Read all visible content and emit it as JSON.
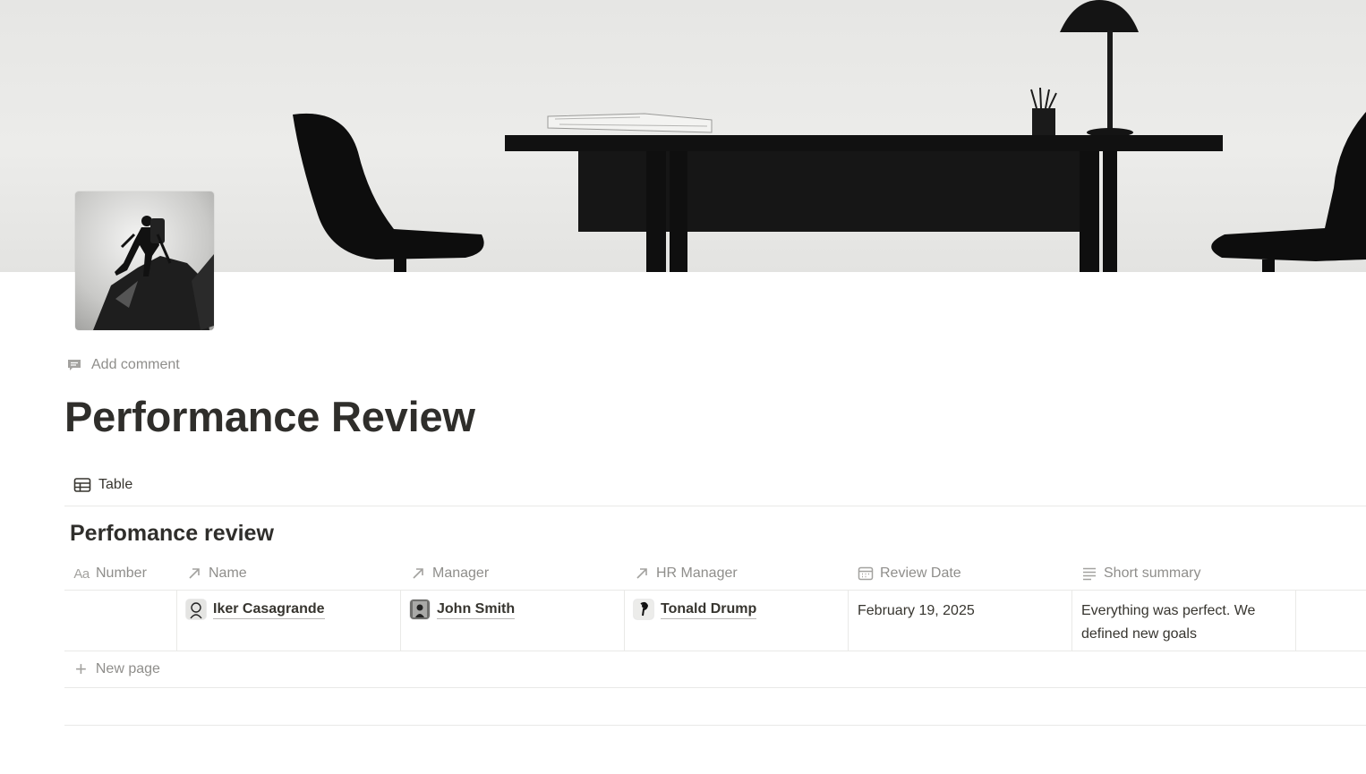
{
  "page": {
    "title": "Performance Review",
    "add_comment": "Add comment"
  },
  "view": {
    "tab_label": "Table"
  },
  "database": {
    "title": "Perfomance review",
    "columns": [
      {
        "label": "Number",
        "icon": "title-aa-icon"
      },
      {
        "label": "Name",
        "icon": "relation-arrow-icon"
      },
      {
        "label": "Manager",
        "icon": "relation-arrow-icon"
      },
      {
        "label": "HR Manager",
        "icon": "relation-arrow-icon"
      },
      {
        "label": "Review Date",
        "icon": "calendar-icon"
      },
      {
        "label": "Short summary",
        "icon": "text-lines-icon"
      }
    ],
    "rows": [
      {
        "number": "",
        "name": "Iker Casagrande",
        "manager": "John Smith",
        "hr_manager": "Tonald Drump",
        "review_date": "February 19, 2025",
        "summary": "Everything was perfect. We defined new goals"
      }
    ],
    "new_page_label": "New page"
  }
}
